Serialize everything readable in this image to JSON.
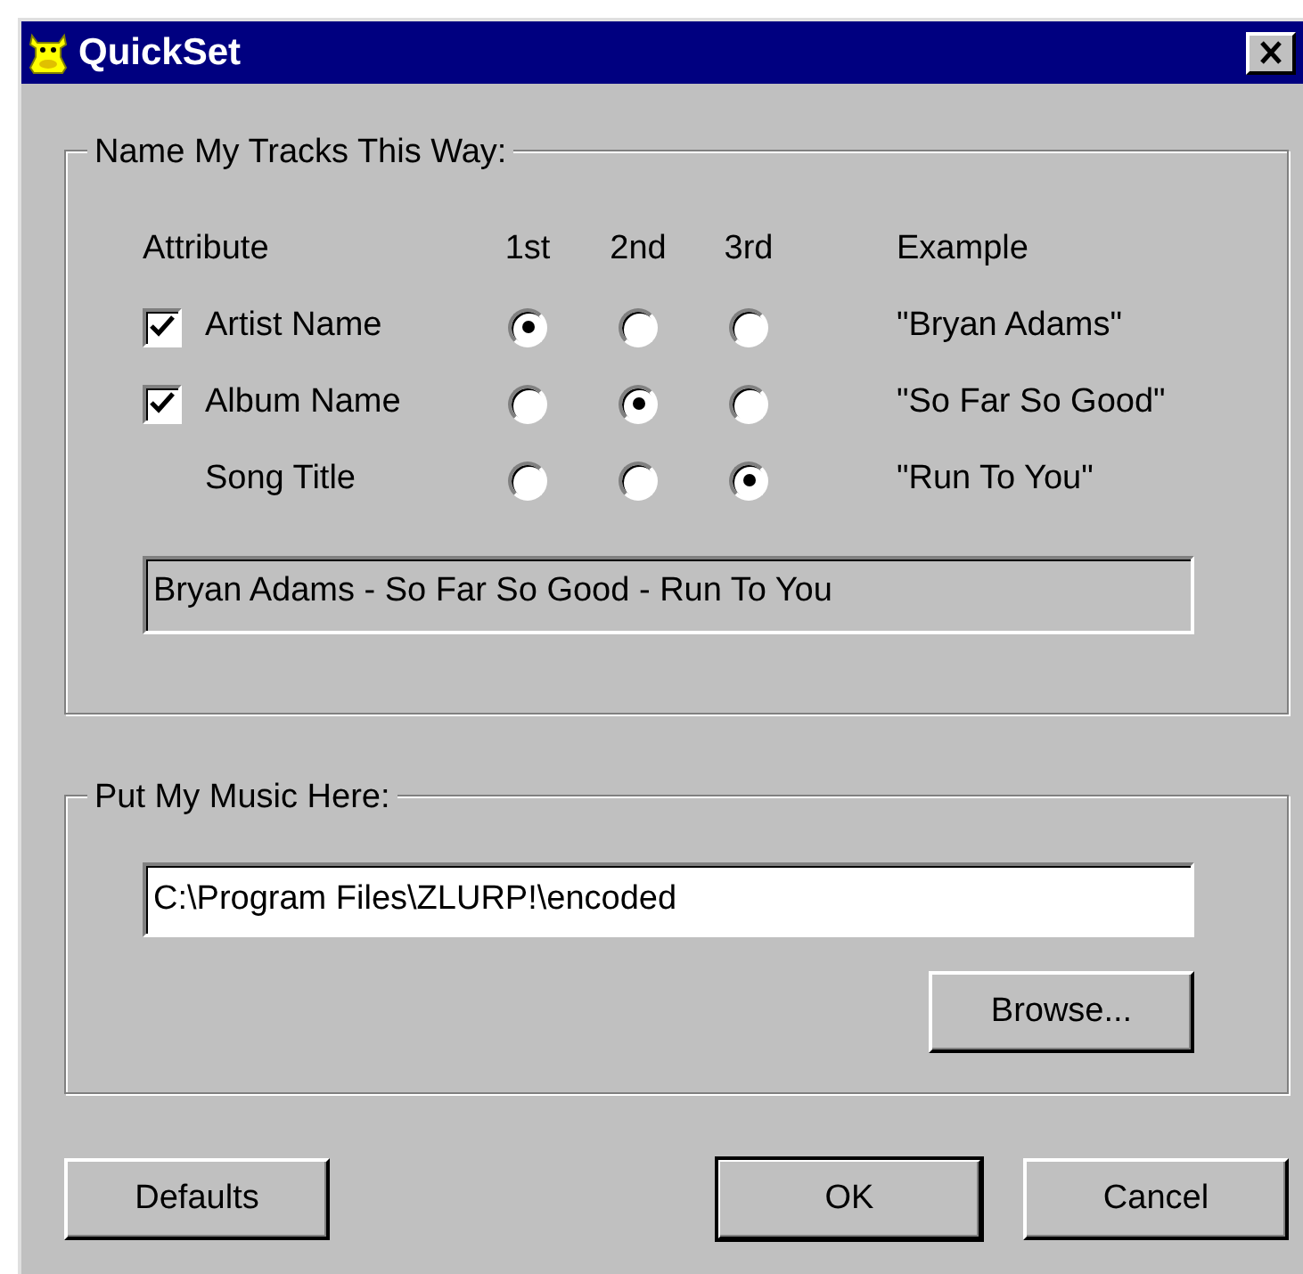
{
  "window": {
    "title": "QuickSet"
  },
  "naming_group": {
    "title": "Name My Tracks This Way:",
    "columns": [
      "Attribute",
      "1st",
      "2nd",
      "3rd",
      "Example"
    ],
    "rows": [
      {
        "kind": "checkbox",
        "checked": true,
        "label": "Artist Name",
        "options": [
          {
            "selected": true
          },
          {
            "selected": false
          },
          {
            "selected": false
          }
        ],
        "example": "\"Bryan Adams\""
      },
      {
        "kind": "checkbox",
        "checked": true,
        "label": "Album Name",
        "options": [
          {
            "selected": false
          },
          {
            "selected": true
          },
          {
            "selected": false
          }
        ],
        "example": "\"So Far So Good\""
      },
      {
        "kind": "plain",
        "label": "Song Title",
        "options": [
          {
            "selected": false
          },
          {
            "selected": false
          },
          {
            "selected": true
          }
        ],
        "example": "\"Run To You\""
      }
    ],
    "preview": "Bryan Adams - So Far So Good - Run To You"
  },
  "location_group": {
    "title": "Put My Music Here:",
    "path": "C:\\Program Files\\ZLURP!\\encoded",
    "browse_button": "Browse..."
  },
  "buttons": [
    {
      "label": "Defaults",
      "kind": "left"
    },
    {
      "label": "OK",
      "kind": "default"
    },
    {
      "label": "Cancel",
      "kind": "normal"
    }
  ]
}
